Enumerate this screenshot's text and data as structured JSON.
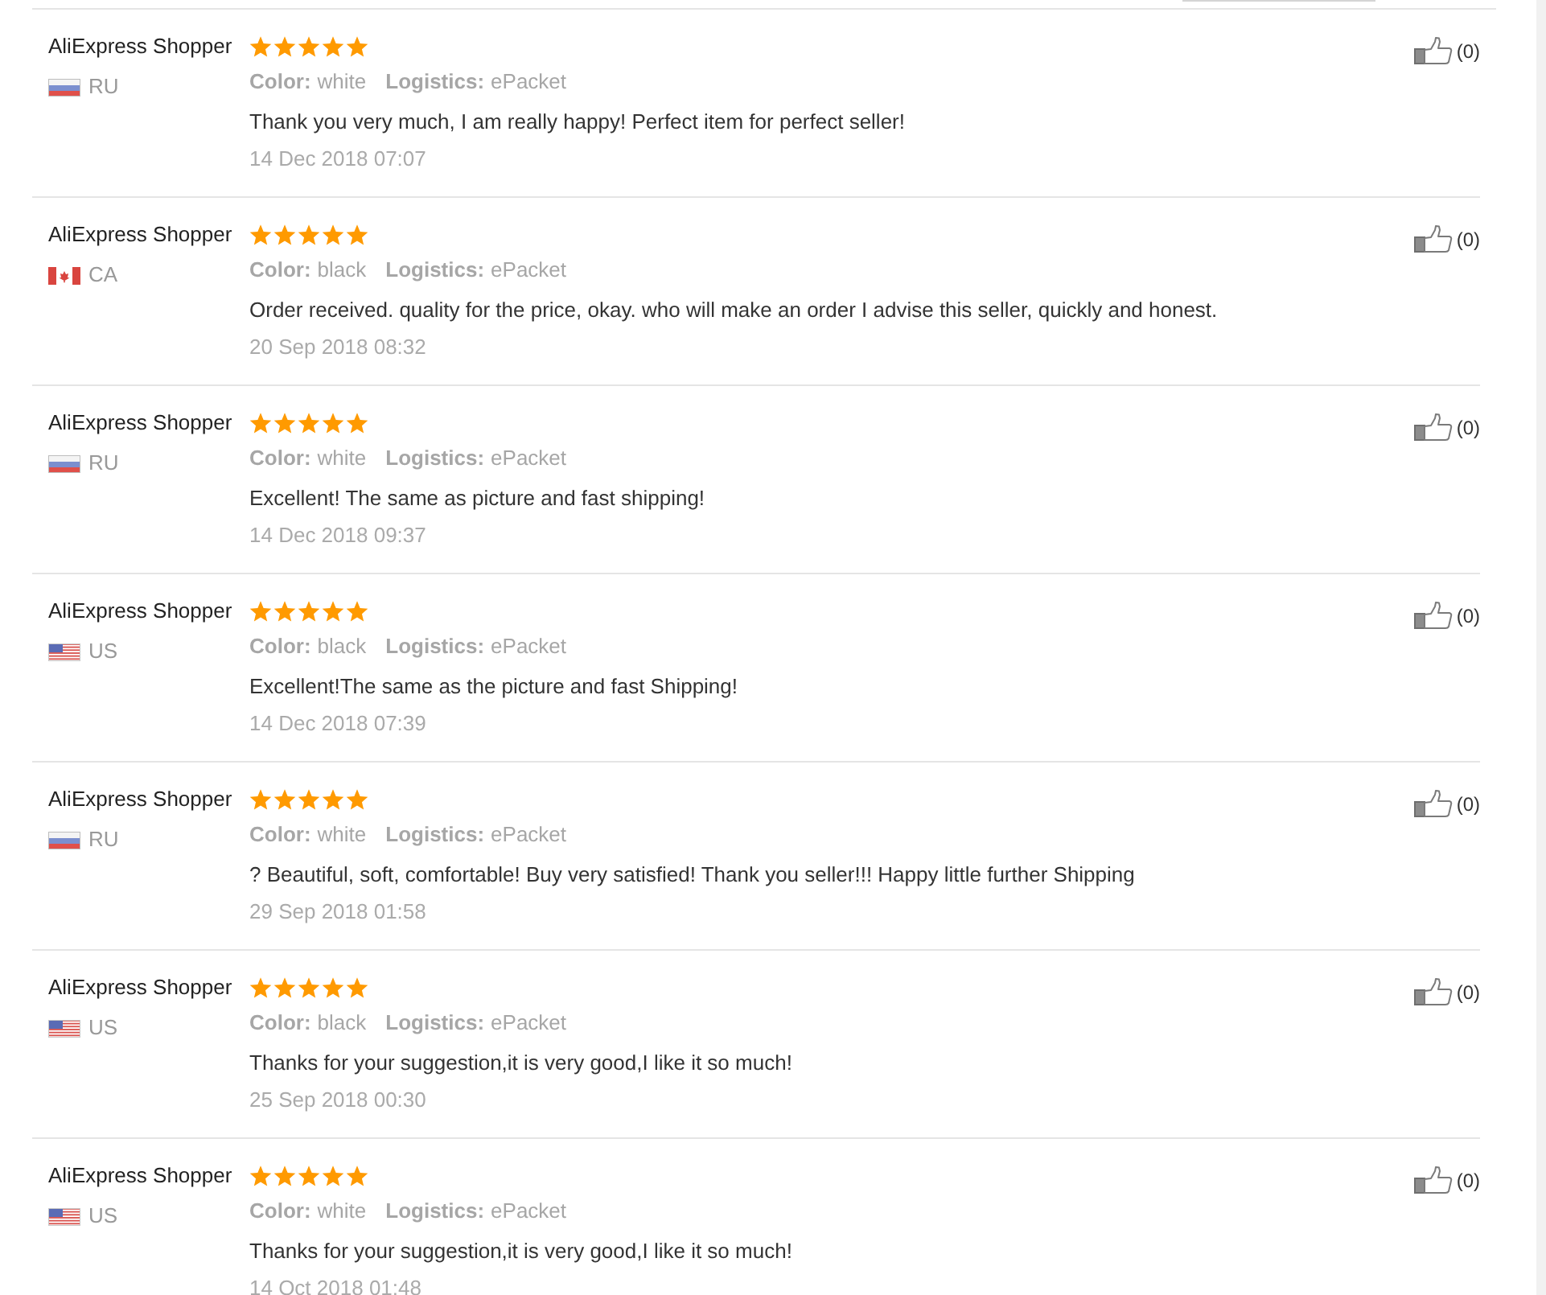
{
  "reviews": [
    {
      "author": "AliExpress Shopper",
      "flag": {
        "kind": "russia"
      },
      "country": "RU",
      "stars": 5,
      "attributes": [
        {
          "label": "Color:",
          "value": "white"
        },
        {
          "label": "Logistics:",
          "value": "ePacket"
        }
      ],
      "text": "Thank you very much, I am really happy! Perfect item for perfect seller!",
      "date": "14 Dec 2018 07:07",
      "likes": "(0)"
    },
    {
      "author": "AliExpress Shopper",
      "flag": {
        "kind": "canada"
      },
      "country": "CA",
      "stars": 5,
      "attributes": [
        {
          "label": "Color:",
          "value": "black"
        },
        {
          "label": "Logistics:",
          "value": "ePacket"
        }
      ],
      "text": "Order received. quality for the price, okay. who will make an order I advise this seller, quickly and honest.",
      "date": "20 Sep 2018 08:32",
      "likes": "(0)"
    },
    {
      "author": "AliExpress Shopper",
      "flag": {
        "kind": "russia"
      },
      "country": "RU",
      "stars": 5,
      "attributes": [
        {
          "label": "Color:",
          "value": "white"
        },
        {
          "label": "Logistics:",
          "value": "ePacket"
        }
      ],
      "text": "Excellent! The same as picture and fast shipping!",
      "date": "14 Dec 2018 09:37",
      "likes": "(0)"
    },
    {
      "author": "AliExpress Shopper",
      "flag": {
        "kind": "usa"
      },
      "country": "US",
      "stars": 5,
      "attributes": [
        {
          "label": "Color:",
          "value": "black"
        },
        {
          "label": "Logistics:",
          "value": "ePacket"
        }
      ],
      "text": "Excellent!The same as the picture and fast Shipping!",
      "date": "14 Dec 2018 07:39",
      "likes": "(0)"
    },
    {
      "author": "AliExpress Shopper",
      "flag": {
        "kind": "russia"
      },
      "country": "RU",
      "stars": 5,
      "attributes": [
        {
          "label": "Color:",
          "value": "white"
        },
        {
          "label": "Logistics:",
          "value": "ePacket"
        }
      ],
      "text": "? Beautiful, soft, comfortable! Buy very satisfied! Thank you seller!!! Happy little further Shipping",
      "date": "29 Sep 2018 01:58",
      "likes": "(0)"
    },
    {
      "author": "AliExpress Shopper",
      "flag": {
        "kind": "usa"
      },
      "country": "US",
      "stars": 5,
      "attributes": [
        {
          "label": "Color:",
          "value": "black"
        },
        {
          "label": "Logistics:",
          "value": "ePacket"
        }
      ],
      "text": "Thanks for your suggestion,it is very good,I like it so much!",
      "date": "25 Sep 2018 00:30",
      "likes": "(0)"
    },
    {
      "author": "AliExpress Shopper",
      "flag": {
        "kind": "usa"
      },
      "country": "US",
      "stars": 5,
      "attributes": [
        {
          "label": "Color:",
          "value": "white"
        },
        {
          "label": "Logistics:",
          "value": "ePacket"
        }
      ],
      "text": "Thanks for your suggestion,it is very good,I like it so much!",
      "date": "14 Oct 2018 01:48",
      "likes": "(0)"
    }
  ]
}
